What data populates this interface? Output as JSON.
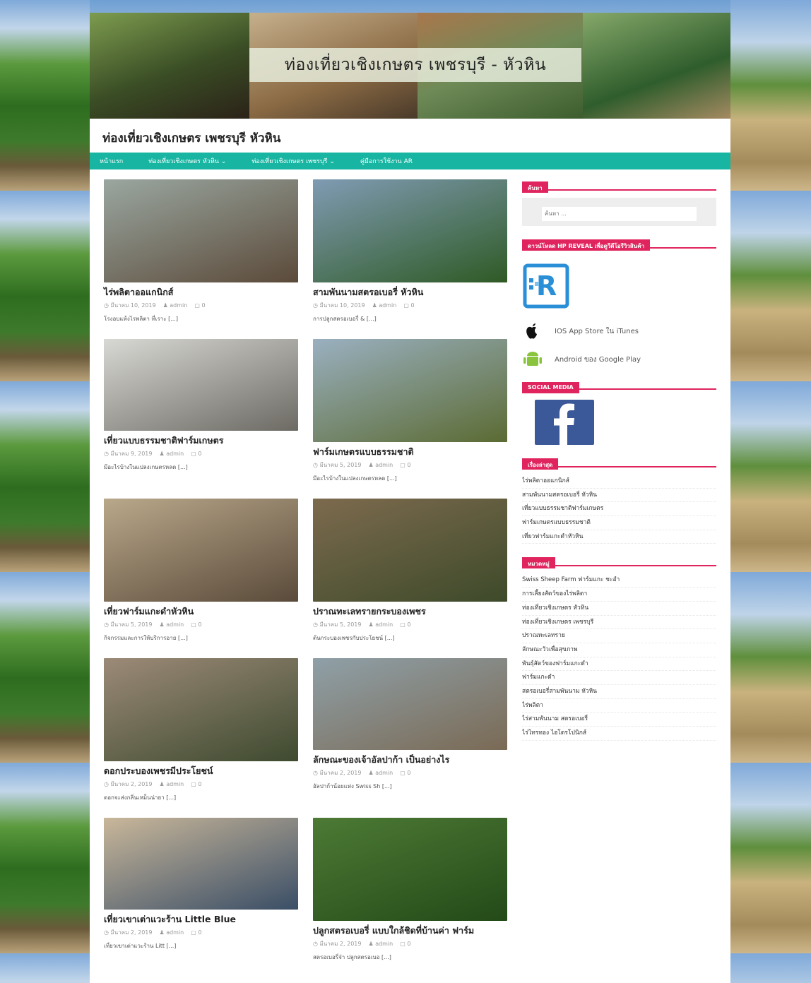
{
  "site": {
    "banner_title": "ท่องเที่ยวเชิงเกษตร เพชรบุรี - หัวหิน",
    "title": "ท่องเที่ยวเชิงเกษตร เพชรบุรี หัวหิน"
  },
  "nav": {
    "items": [
      {
        "label": "หน้าแรก"
      },
      {
        "label": "ท่องเที่ยวเชิงเกษตร หัวหิน ⌄"
      },
      {
        "label": "ท่องเที่ยวเชิงเกษตร เพชรบุรี ⌄"
      },
      {
        "label": "คู่มือการใช้งาน AR"
      }
    ]
  },
  "posts": [
    {
      "title": "ไร่พลิตาออแกนิกส์",
      "date": "มีนาคม 10, 2019",
      "author": "admin",
      "comments": "0",
      "excerpt": "โรงอบแห้งไรพลิตา ที่เราะ [...]",
      "thumb_color": "#9aa7a0",
      "thumb_color2": "#5b4a3a"
    },
    {
      "title": "สามพันนามสตรอเบอรี่ หัวหิน",
      "date": "มีนาคม 10, 2019",
      "author": "admin",
      "comments": "0",
      "excerpt": "การปลูกสตรอเบอรี่ & [...]",
      "thumb_color": "#7f9bb3",
      "thumb_color2": "#2f5a25"
    },
    {
      "title": "เที่ยวแบบธรรมชาติฟาร์มเกษตร",
      "date": "มีนาคม 9, 2019",
      "author": "admin",
      "comments": "0",
      "excerpt": "มีอะไรบ้างในแปลงเกษตรหลด [...]",
      "thumb_color": "#d8d8d4",
      "thumb_color2": "#6c6a63"
    },
    {
      "title": "ฟาร์มเกษตรแบบธรรมชาติ",
      "date": "มีนาคม 5, 2019",
      "author": "admin",
      "comments": "0",
      "excerpt": "มีอะไรบ้างในแปลงเกษตรหลด [...]",
      "thumb_color": "#9ab0c0",
      "thumb_color2": "#5b6b33"
    },
    {
      "title": "เที่ยวฟาร์มแกะดำหัวหิน",
      "date": "มีนาคม 5, 2019",
      "author": "admin",
      "comments": "0",
      "excerpt": "กิจกรรมและการให้บริการอาย [...]",
      "thumb_color": "#b9a88a",
      "thumb_color2": "#5a4a3a"
    },
    {
      "title": "ปราณทะเลทรายกระบองเพชร",
      "date": "มีนาคม 5, 2019",
      "author": "admin",
      "comments": "0",
      "excerpt": "ต้นกระบองเพชรกับประโยชน์ [...]",
      "thumb_color": "#7d6a4e",
      "thumb_color2": "#3d4a2a"
    },
    {
      "title": "ดอกประบองเพชรมีประโยชน์",
      "date": "มีนาคม 2, 2019",
      "author": "admin",
      "comments": "0",
      "excerpt": "ดอกจะส่งกลิ่นเหม็นน่ายา [...]",
      "thumb_color": "#9c8a78",
      "thumb_color2": "#3e4a2f"
    },
    {
      "title": "ลักษณะของเจ้าอัลปาก้า เป็นอย่างไร",
      "date": "มีนาคม 2, 2019",
      "author": "admin",
      "comments": "0",
      "excerpt": "อัลปาก้าน้อยแห่ง Swiss Sh [...]",
      "thumb_color": "#8fa0a8",
      "thumb_color2": "#7a6a55"
    },
    {
      "title": "เที่ยวเขาเต่าแวะร้าน Little Blue",
      "date": "มีนาคม 2, 2019",
      "author": "admin",
      "comments": "0",
      "excerpt": "เที่ยวเขาเต่าแวะร้าน Litt [...]",
      "thumb_color": "#c9b79a",
      "thumb_color2": "#3a4e66"
    },
    {
      "title": "ปลูกสตรอเบอรี่ แบบใกล้ชิดที่บ้านค่า ฟาร์ม",
      "date": "มีนาคม 2, 2019",
      "author": "admin",
      "comments": "0",
      "excerpt": "สตรอเบอรี่จ๋า ปลูกสตรอเบอ [...]",
      "thumb_color": "#4d7a35",
      "thumb_color2": "#234a18"
    }
  ],
  "sidebar": {
    "search": {
      "title": "ค้นหา",
      "placeholder": "ค้นหา ..."
    },
    "download": {
      "title": "ดาวน์โหลด HP REVEAL เพื่อดูวีดีโอรีวิวสินค้า",
      "ios_label": "IOS App Store ใน iTunes",
      "android_label": "Android ของ Google Play"
    },
    "social": {
      "title": "SOCIAL MEDIA"
    },
    "recent": {
      "title": "เรื่องล่าสุด",
      "items": [
        "ไร่พลิตาออแกนิกส์",
        "สามพันนามสตรอเบอรี่ หัวหิน",
        "เที่ยวแบบธรรมชาติฟาร์มเกษตร",
        "ฟาร์มเกษตรแบบธรรมชาติ",
        "เที่ยวฟาร์มแกะดำหัวหิน"
      ]
    },
    "categories": {
      "title": "หมวดหมู่",
      "items": [
        "Swiss Sheep Farm ฟาร์มแกะ ชะอำ",
        "การเลี้ยงสัตว์ของไร่พลิตา",
        "ท่องเที่ยวเชิงเกษตร หัวหิน",
        "ท่องเที่ยวเชิงเกษตร เพชรบุรี",
        "ปราณทะเลทราย",
        "ลักษณะวัวเพื่อสุขภาพ",
        "พันธุ์สัตว์ของฟาร์มแกะดำ",
        "ฟาร์มแกะดำ",
        "สตรอเบอรี่สามพันนาม หัวหิน",
        "ไร่พลิตา",
        "ไร่สามพันนาม สตรอเบอรี่",
        "ไร่ไทรทอง ไฮโดรโปนิกส์"
      ]
    }
  }
}
